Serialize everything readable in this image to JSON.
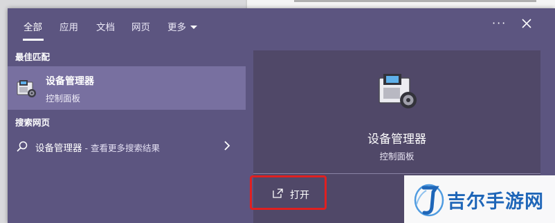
{
  "header": {
    "tabs": [
      {
        "label": "全部",
        "active": true
      },
      {
        "label": "应用"
      },
      {
        "label": "文档"
      },
      {
        "label": "网页"
      },
      {
        "label": "更多"
      }
    ],
    "more_icon": "ellipsis-icon",
    "close_icon": "close-icon"
  },
  "best_match": {
    "heading": "最佳匹配",
    "title": "设备管理器",
    "subtitle": "控制面板",
    "icon": "device-manager-icon"
  },
  "web_search": {
    "heading": "搜索网页",
    "query": "设备管理器",
    "suffix": " - 查看更多搜索结果"
  },
  "detail": {
    "title": "设备管理器",
    "subtitle": "控制面板",
    "action_label": "打开"
  },
  "watermark": {
    "text": "吉尔手游网"
  },
  "colors": {
    "panel": "#5c5580",
    "selected": "#7870a0",
    "card": "#504868",
    "highlight": "#e02020",
    "watermark": "#1f66b8"
  }
}
